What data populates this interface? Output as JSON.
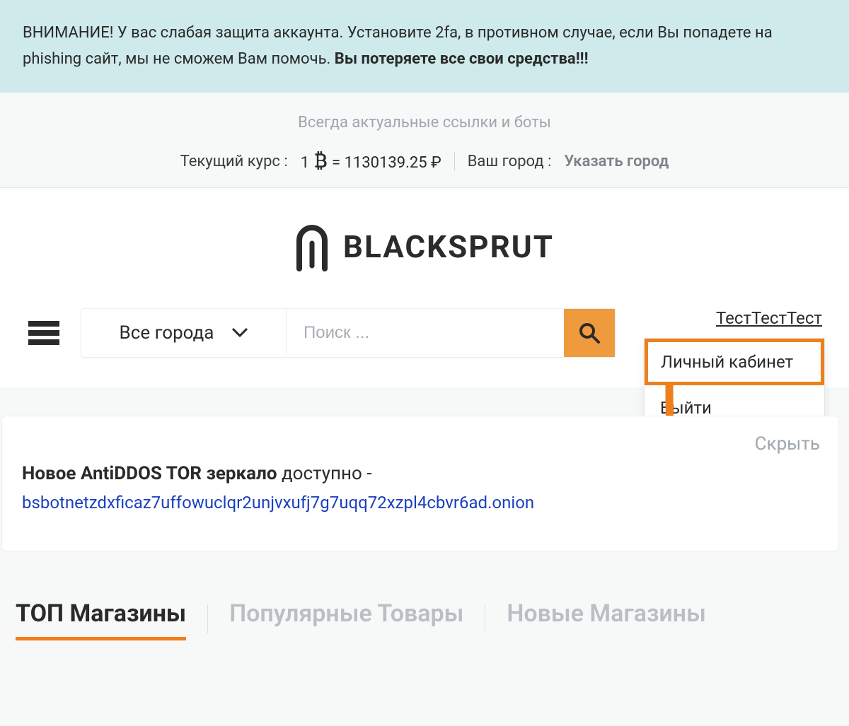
{
  "alert": {
    "text": "ВНИМАНИЕ! У вас слабая защита аккаунта. Установите 2fa, в противном случае, если Вы попадете на phishing сайт, мы не сможем Вам помочь. ",
    "bold": "Вы потеряете все свои средства!!!"
  },
  "topbar": {
    "tagline": "Всегда актуальные ссылки и боты",
    "rate_label": "Текущий курс :",
    "rate_prefix": "1",
    "rate_value": " = 1130139.25 ₽",
    "city_label": "Ваш город :",
    "city_value": "Указать город"
  },
  "logo": {
    "word": "BLACKSPRUT"
  },
  "search": {
    "city_select": "Все города",
    "placeholder": "Поиск ..."
  },
  "user": {
    "name": "ТестТестТест",
    "menu": {
      "profile": "Личный кабинет",
      "logout": "Выйти"
    }
  },
  "notice": {
    "hide": "Скрыть",
    "strong": "Новое AntiDDOS TOR зеркало",
    "after": " доступно -",
    "onion": "bsbotnetzdxficaz7uffowuclqr2unjvxufj7g7uqq72xzpl4cbvr6ad.onion"
  },
  "tabs": {
    "top_shops": "ТОП Магазины",
    "popular": "Популярные Товары",
    "new_shops": "Новые Магазины"
  }
}
